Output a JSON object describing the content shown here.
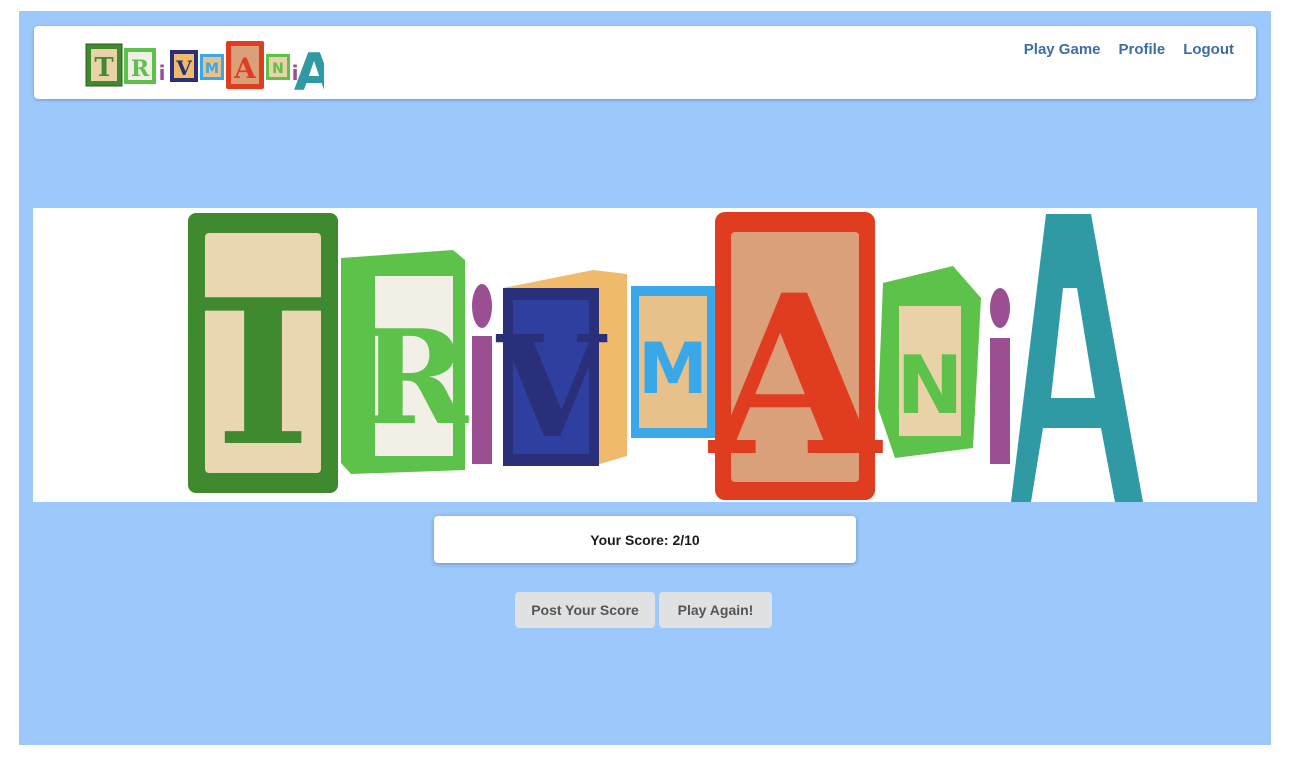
{
  "app": {
    "logo_letters": [
      "T",
      "R",
      "i",
      "V",
      "M",
      "A",
      "N",
      "i",
      "A"
    ]
  },
  "nav": {
    "items": [
      {
        "label": "Play Game"
      },
      {
        "label": "Profile"
      },
      {
        "label": "Logout"
      }
    ]
  },
  "result": {
    "score_text": "Your Score: 2/10"
  },
  "actions": {
    "post_label": "Post Your Score",
    "again_label": "Play Again!"
  },
  "colors": {
    "page_background": "#9dc8fb",
    "nav_link": "#3a6ea5",
    "block_green": "#3f8a2e",
    "block_lightgreen": "#5cc24a",
    "block_navy": "#2a2f7a",
    "block_blue": "#3aa7e8",
    "block_red": "#e03c1f",
    "block_purple": "#9b4f92",
    "block_teal": "#2f9aa3"
  }
}
